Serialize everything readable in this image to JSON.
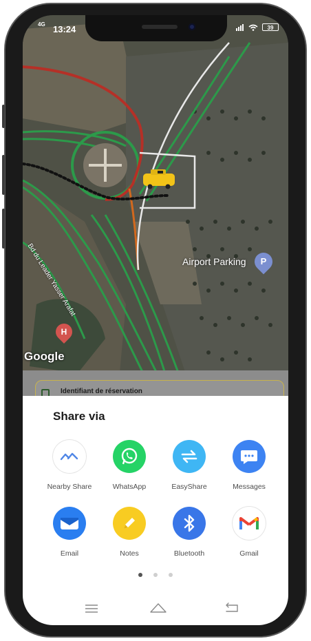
{
  "status_bar": {
    "time": "13:24",
    "network": "4G",
    "battery": "39"
  },
  "map": {
    "airport_parking_label": "Airport Parking",
    "parking_poi": "P",
    "hospital_poi": "H",
    "street_label": "Bd du Leader Yasser Arafat",
    "google_logo": "Google"
  },
  "reservation": {
    "label": "Identifiant de réservation"
  },
  "share_sheet": {
    "title": "Share via",
    "apps": [
      {
        "label": "Nearby Share",
        "color": "#e8f0fe"
      },
      {
        "label": "WhatsApp",
        "color": "#25d366"
      },
      {
        "label": "EasyShare",
        "color": "#3fb6f4"
      },
      {
        "label": "Messages",
        "color": "#3d83f2"
      },
      {
        "label": "Email",
        "color": "#2a7ef0"
      },
      {
        "label": "Notes",
        "color": "#f8cc22"
      },
      {
        "label": "Bluetooth",
        "color": "#3976e8"
      },
      {
        "label": "Gmail",
        "color": "#ffffff"
      }
    ],
    "page_dots": 3,
    "active_page": 1
  }
}
